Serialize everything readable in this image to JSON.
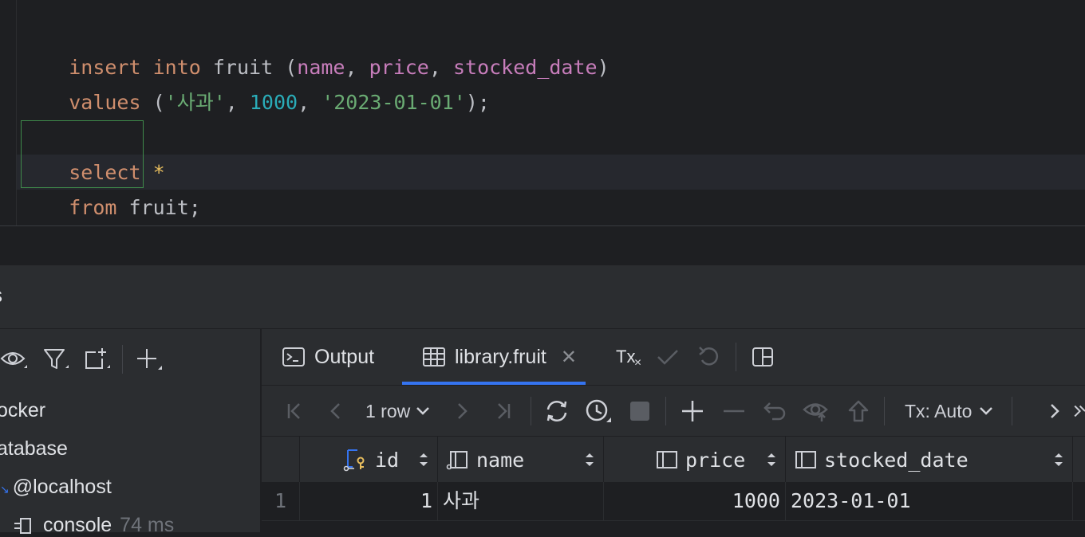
{
  "editor": {
    "line1": {
      "insert": "insert",
      "into": "into",
      "table": "fruit",
      "open": "(",
      "c1": "name",
      "comma1": ", ",
      "c2": "price",
      "comma2": ", ",
      "c3": "stocked_date",
      "close": ")"
    },
    "line2": {
      "values": "values",
      "open": "(",
      "s1": "'사과'",
      "comma1": ", ",
      "n1": "1000",
      "comma2": ", ",
      "s2": "'2023-01-01'",
      "close": ");"
    },
    "line4": {
      "select": "select",
      "star": "*"
    },
    "line5": {
      "from": "from",
      "table": "fruit",
      "semi": ";"
    }
  },
  "services": {
    "title": "s"
  },
  "tree": {
    "items": [
      {
        "label": "ocker"
      },
      {
        "label": "atabase"
      },
      {
        "label": "@localhost"
      },
      {
        "label": "console",
        "time": "74 ms"
      }
    ]
  },
  "tabs": {
    "output": "Output",
    "table": "library.fruit",
    "tx": "Tx"
  },
  "toolbar": {
    "rows": "1 row",
    "tx_mode": "Tx: Auto"
  },
  "grid": {
    "columns": [
      "id",
      "name",
      "price",
      "stocked_date"
    ],
    "rows": [
      {
        "num": "1",
        "id": "1",
        "name": "사과",
        "price": "1000",
        "stocked_date": "2023-01-01"
      }
    ]
  },
  "colors": {
    "keyword": "#cf8e6d",
    "column": "#c77dbb",
    "string": "#6aab73",
    "number": "#2aacb8",
    "accent": "#3574f0"
  }
}
